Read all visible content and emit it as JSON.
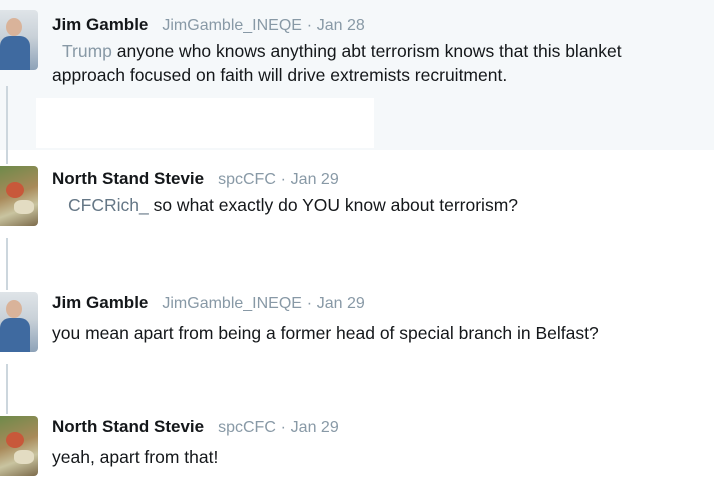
{
  "tweets": [
    {
      "author": "Jim Gamble",
      "handle": "JimGamble_INEQE",
      "separator": "·",
      "date": "Jan 28",
      "mention": "Trump",
      "text_line1": " anyone who knows anything abt terrorism knows that this blanket",
      "text_line2": "approach focused on faith will drive extremists recruitment."
    },
    {
      "author": "North Stand Stevie",
      "handle": "spcCFC",
      "separator": "·",
      "date": "Jan 29",
      "mention": "CFCRich_",
      "text": " so what exactly do YOU know about terrorism?"
    },
    {
      "author": "Jim Gamble",
      "handle": "JimGamble_INEQE",
      "separator": "·",
      "date": "Jan 29",
      "text": "you mean apart from being a former head of special branch in Belfast?"
    },
    {
      "author": "North Stand Stevie",
      "handle": "spcCFC",
      "separator": "·",
      "date": "Jan 29",
      "text": "yeah, apart from that!"
    }
  ]
}
